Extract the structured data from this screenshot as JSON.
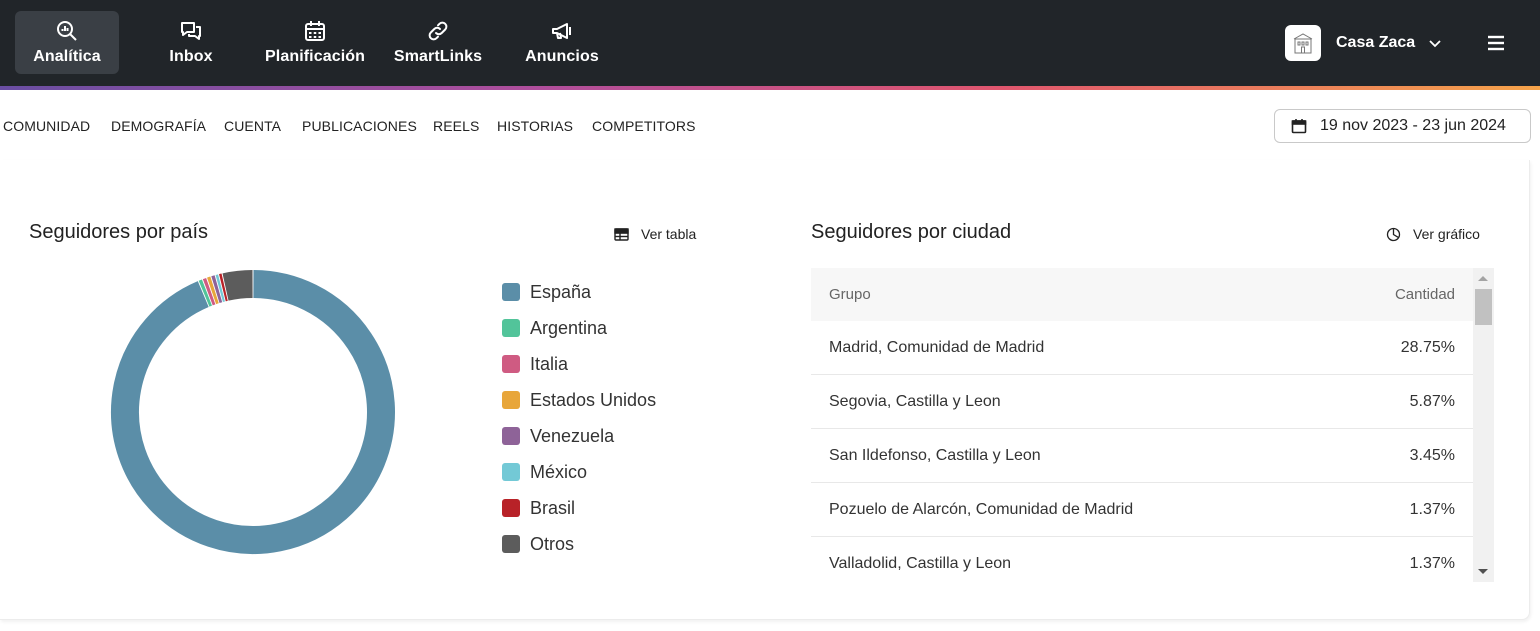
{
  "topnav": {
    "items": [
      {
        "label": "Analítica",
        "icon": "analytics-icon",
        "active": true
      },
      {
        "label": "Inbox",
        "icon": "chat-icon",
        "active": false
      },
      {
        "label": "Planificación",
        "icon": "calendar-icon",
        "active": false
      },
      {
        "label": "SmartLinks",
        "icon": "link-icon",
        "active": false
      },
      {
        "label": "Anuncios",
        "icon": "megaphone-icon",
        "active": false
      }
    ],
    "account_name": "Casa Zaca"
  },
  "subnav": {
    "tabs": [
      "COMUNIDAD",
      "DEMOGRAFÍA",
      "CUENTA",
      "PUBLICACIONES",
      "REELS",
      "HISTORIAS",
      "COMPETITORS"
    ],
    "date_range": "19 nov 2023 - 23 jun 2024"
  },
  "country_section": {
    "title": "Seguidores por país",
    "toggle_label": "Ver tabla"
  },
  "city_section": {
    "title": "Seguidores por ciudad",
    "toggle_label": "Ver gráfico",
    "columns": [
      "Grupo",
      "Cantidad"
    ],
    "rows": [
      {
        "group": "Madrid, Comunidad de Madrid",
        "amount": "28.75%"
      },
      {
        "group": "Segovia, Castilla y Leon",
        "amount": "5.87%"
      },
      {
        "group": "San Ildefonso, Castilla y Leon",
        "amount": "3.45%"
      },
      {
        "group": "Pozuelo de Alarcón, Comunidad de Madrid",
        "amount": "1.37%"
      },
      {
        "group": "Valladolid, Castilla y Leon",
        "amount": "1.37%"
      }
    ]
  },
  "chart_data": {
    "type": "pie",
    "donut": true,
    "categories": [
      "España",
      "Argentina",
      "Italia",
      "Estados Unidos",
      "Venezuela",
      "México",
      "Brasil",
      "Otros"
    ],
    "values": [
      93.7,
      0.5,
      0.5,
      0.5,
      0.5,
      0.4,
      0.4,
      3.5
    ],
    "colors": [
      "#5b8ea8",
      "#52c49a",
      "#cf5b82",
      "#e8a63a",
      "#8e6398",
      "#73c9d6",
      "#b82228",
      "#5c5c5c"
    ],
    "legend_position": "right"
  }
}
